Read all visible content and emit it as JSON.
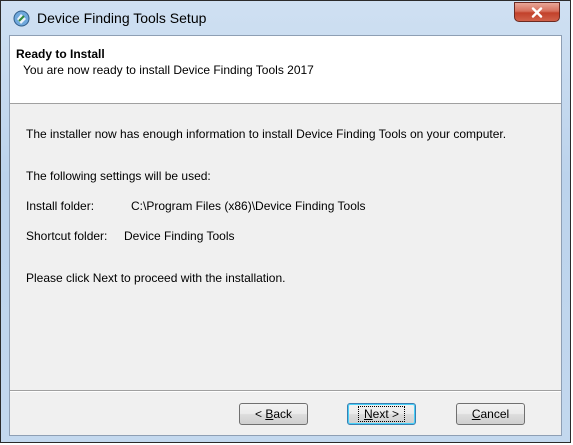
{
  "window": {
    "title": "Device Finding Tools Setup",
    "icon": "installer-icon",
    "close_icon": "close-icon"
  },
  "banner": {
    "heading": "Ready to Install",
    "subheading": "You are now ready to install Device Finding Tools 2017"
  },
  "body": {
    "intro": "The installer now has enough information to install Device Finding Tools on your computer.",
    "settings_heading": "The following settings will be used:",
    "install_folder_label": "Install folder:",
    "install_folder_value": "C:\\Program Files (x86)\\Device Finding Tools",
    "shortcut_folder_label": "Shortcut folder:",
    "shortcut_folder_value": "Device Finding Tools",
    "instruction": "Please click Next to proceed with the installation."
  },
  "buttons": {
    "back": {
      "prefix": "< ",
      "mnemonic": "B",
      "rest": "ack"
    },
    "next": {
      "mnemonic": "N",
      "rest": "ext >"
    },
    "cancel": {
      "mnemonic": "C",
      "rest": "ancel"
    }
  },
  "colors": {
    "frame": "#c3d8ee",
    "close_button": "#c2412b",
    "default_button_border": "#3c7fb1"
  }
}
